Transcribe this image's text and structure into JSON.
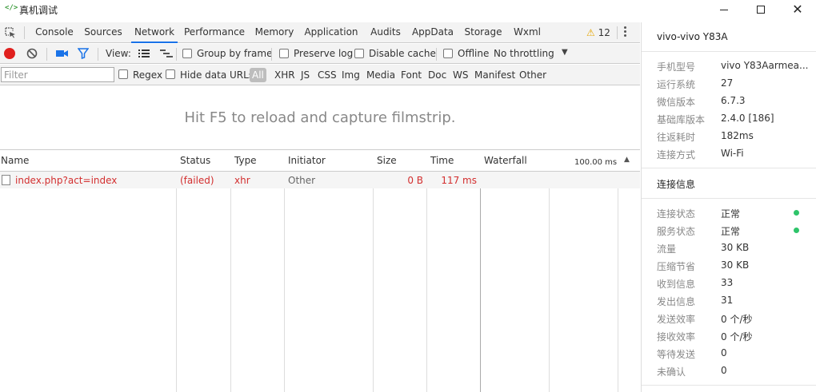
{
  "window": {
    "title": "真机调试",
    "icon_glyph": "</>"
  },
  "tabs": [
    {
      "label": "Console"
    },
    {
      "label": "Sources"
    },
    {
      "label": "Network",
      "active": true
    },
    {
      "label": "Performance"
    },
    {
      "label": "Memory"
    },
    {
      "label": "Application"
    },
    {
      "label": "Audits"
    },
    {
      "label": "AppData"
    },
    {
      "label": "Storage"
    },
    {
      "label": "Wxml"
    }
  ],
  "warnings": {
    "count": "12"
  },
  "network_toolbar": {
    "view_label": "View:",
    "group_by_frame": "Group by frame",
    "preserve_log": "Preserve log",
    "disable_cache": "Disable cache",
    "offline": "Offline",
    "throttling": "No throttling"
  },
  "filter_bar": {
    "placeholder": "Filter",
    "regex": "Regex",
    "hide_data_urls": "Hide data URLs",
    "types": [
      "All",
      "XHR",
      "JS",
      "CSS",
      "Img",
      "Media",
      "Font",
      "Doc",
      "WS",
      "Manifest",
      "Other"
    ]
  },
  "filmstrip": {
    "message": "Hit F5 to reload and capture filmstrip."
  },
  "table": {
    "headers": {
      "name": "Name",
      "status": "Status",
      "type": "Type",
      "initiator": "Initiator",
      "size": "Size",
      "time": "Time",
      "waterfall": "Waterfall",
      "waterfall_scale": "100.00 ms"
    },
    "rows": [
      {
        "name": "index.php?act=index",
        "status": "(failed)",
        "type": "xhr",
        "initiator": "Other",
        "size": "0 B",
        "time": "117 ms"
      }
    ]
  },
  "device_panel": {
    "device": "vivo-vivo Y83A",
    "info": [
      {
        "key": "手机型号",
        "value": "vivo Y83Aarmea..."
      },
      {
        "key": "运行系统",
        "value": "27"
      },
      {
        "key": "微信版本",
        "value": "6.7.3"
      },
      {
        "key": "基础库版本",
        "value": "2.4.0 [186]"
      },
      {
        "key": "往返耗时",
        "value": "182ms"
      },
      {
        "key": "连接方式",
        "value": "Wi-Fi"
      }
    ],
    "connection_title": "连接信息",
    "connection": [
      {
        "key": "连接状态",
        "value": "正常"
      },
      {
        "key": "服务状态",
        "value": "正常"
      },
      {
        "key": "流量",
        "value": "30 KB"
      },
      {
        "key": "压缩节省",
        "value": "30 KB"
      },
      {
        "key": "收到信息",
        "value": "33"
      },
      {
        "key": "发出信息",
        "value": "31"
      },
      {
        "key": "发送效率",
        "value": "0 个/秒"
      },
      {
        "key": "接收效率",
        "value": "0 个/秒"
      },
      {
        "key": "等待发送",
        "value": "0"
      },
      {
        "key": "未确认",
        "value": "0"
      }
    ],
    "status_color": "#2ec46a"
  },
  "colors": {
    "record": "#e0201e",
    "error_text": "#d32f2f",
    "active_tab": "#1a73e8",
    "warning": "#e6a500"
  }
}
